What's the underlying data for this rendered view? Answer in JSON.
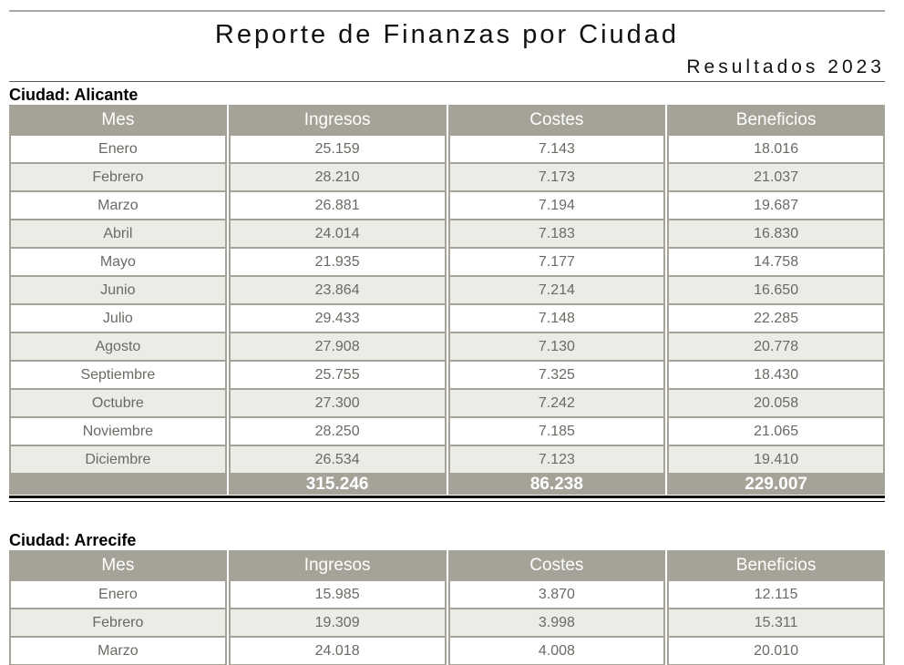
{
  "report": {
    "title": "Reporte de Finanzas por Ciudad",
    "subtitle": "Resultados 2023"
  },
  "columns": [
    "Mes",
    "Ingresos",
    "Costes",
    "Beneficios"
  ],
  "cities": [
    {
      "label": "Ciudad: Alicante",
      "rows": [
        [
          "Enero",
          "25.159",
          "7.143",
          "18.016"
        ],
        [
          "Febrero",
          "28.210",
          "7.173",
          "21.037"
        ],
        [
          "Marzo",
          "26.881",
          "7.194",
          "19.687"
        ],
        [
          "Abril",
          "24.014",
          "7.183",
          "16.830"
        ],
        [
          "Mayo",
          "21.935",
          "7.177",
          "14.758"
        ],
        [
          "Junio",
          "23.864",
          "7.214",
          "16.650"
        ],
        [
          "Julio",
          "29.433",
          "7.148",
          "22.285"
        ],
        [
          "Agosto",
          "27.908",
          "7.130",
          "20.778"
        ],
        [
          "Septiembre",
          "25.755",
          "7.325",
          "18.430"
        ],
        [
          "Octubre",
          "27.300",
          "7.242",
          "20.058"
        ],
        [
          "Noviembre",
          "28.250",
          "7.185",
          "21.065"
        ],
        [
          "Diciembre",
          "26.534",
          "7.123",
          "19.410"
        ]
      ],
      "totals": [
        "",
        "315.246",
        "86.238",
        "229.007"
      ]
    },
    {
      "label": "Ciudad: Arrecife",
      "rows": [
        [
          "Enero",
          "15.985",
          "3.870",
          "12.115"
        ],
        [
          "Febrero",
          "19.309",
          "3.998",
          "15.311"
        ],
        [
          "Marzo",
          "24.018",
          "4.008",
          "20.010"
        ]
      ]
    }
  ]
}
